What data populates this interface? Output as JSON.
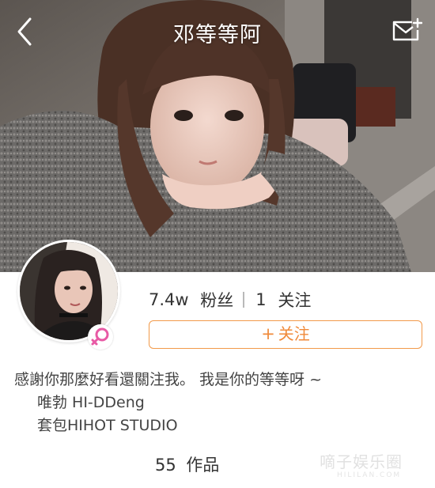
{
  "header": {
    "title": "邓等等阿",
    "back_icon": "chevron-left-icon",
    "message_icon": "mail-plus-icon"
  },
  "profile": {
    "followers_count": "7.4w",
    "followers_label": "粉丝",
    "following_count": "1",
    "following_label": "关注",
    "follow_button_plus": "+",
    "follow_button_label": "关注",
    "gender_icon": "female-symbol-icon"
  },
  "bio": {
    "line1": "感謝你那麼好看還關注我。 我是你的等等呀 ~",
    "line2": "唯勃 HI-DDeng",
    "line3": "套包HIHOT STUDIO"
  },
  "works": {
    "count": "55",
    "label": "作品"
  },
  "watermark": {
    "text": "嘀子娱乐圈",
    "sub": "HILILAN.COM"
  },
  "colors": {
    "accent": "#f08a3a",
    "title_text": "#ffffff",
    "body_text": "#444444",
    "gender_badge": "#e85aa5"
  }
}
